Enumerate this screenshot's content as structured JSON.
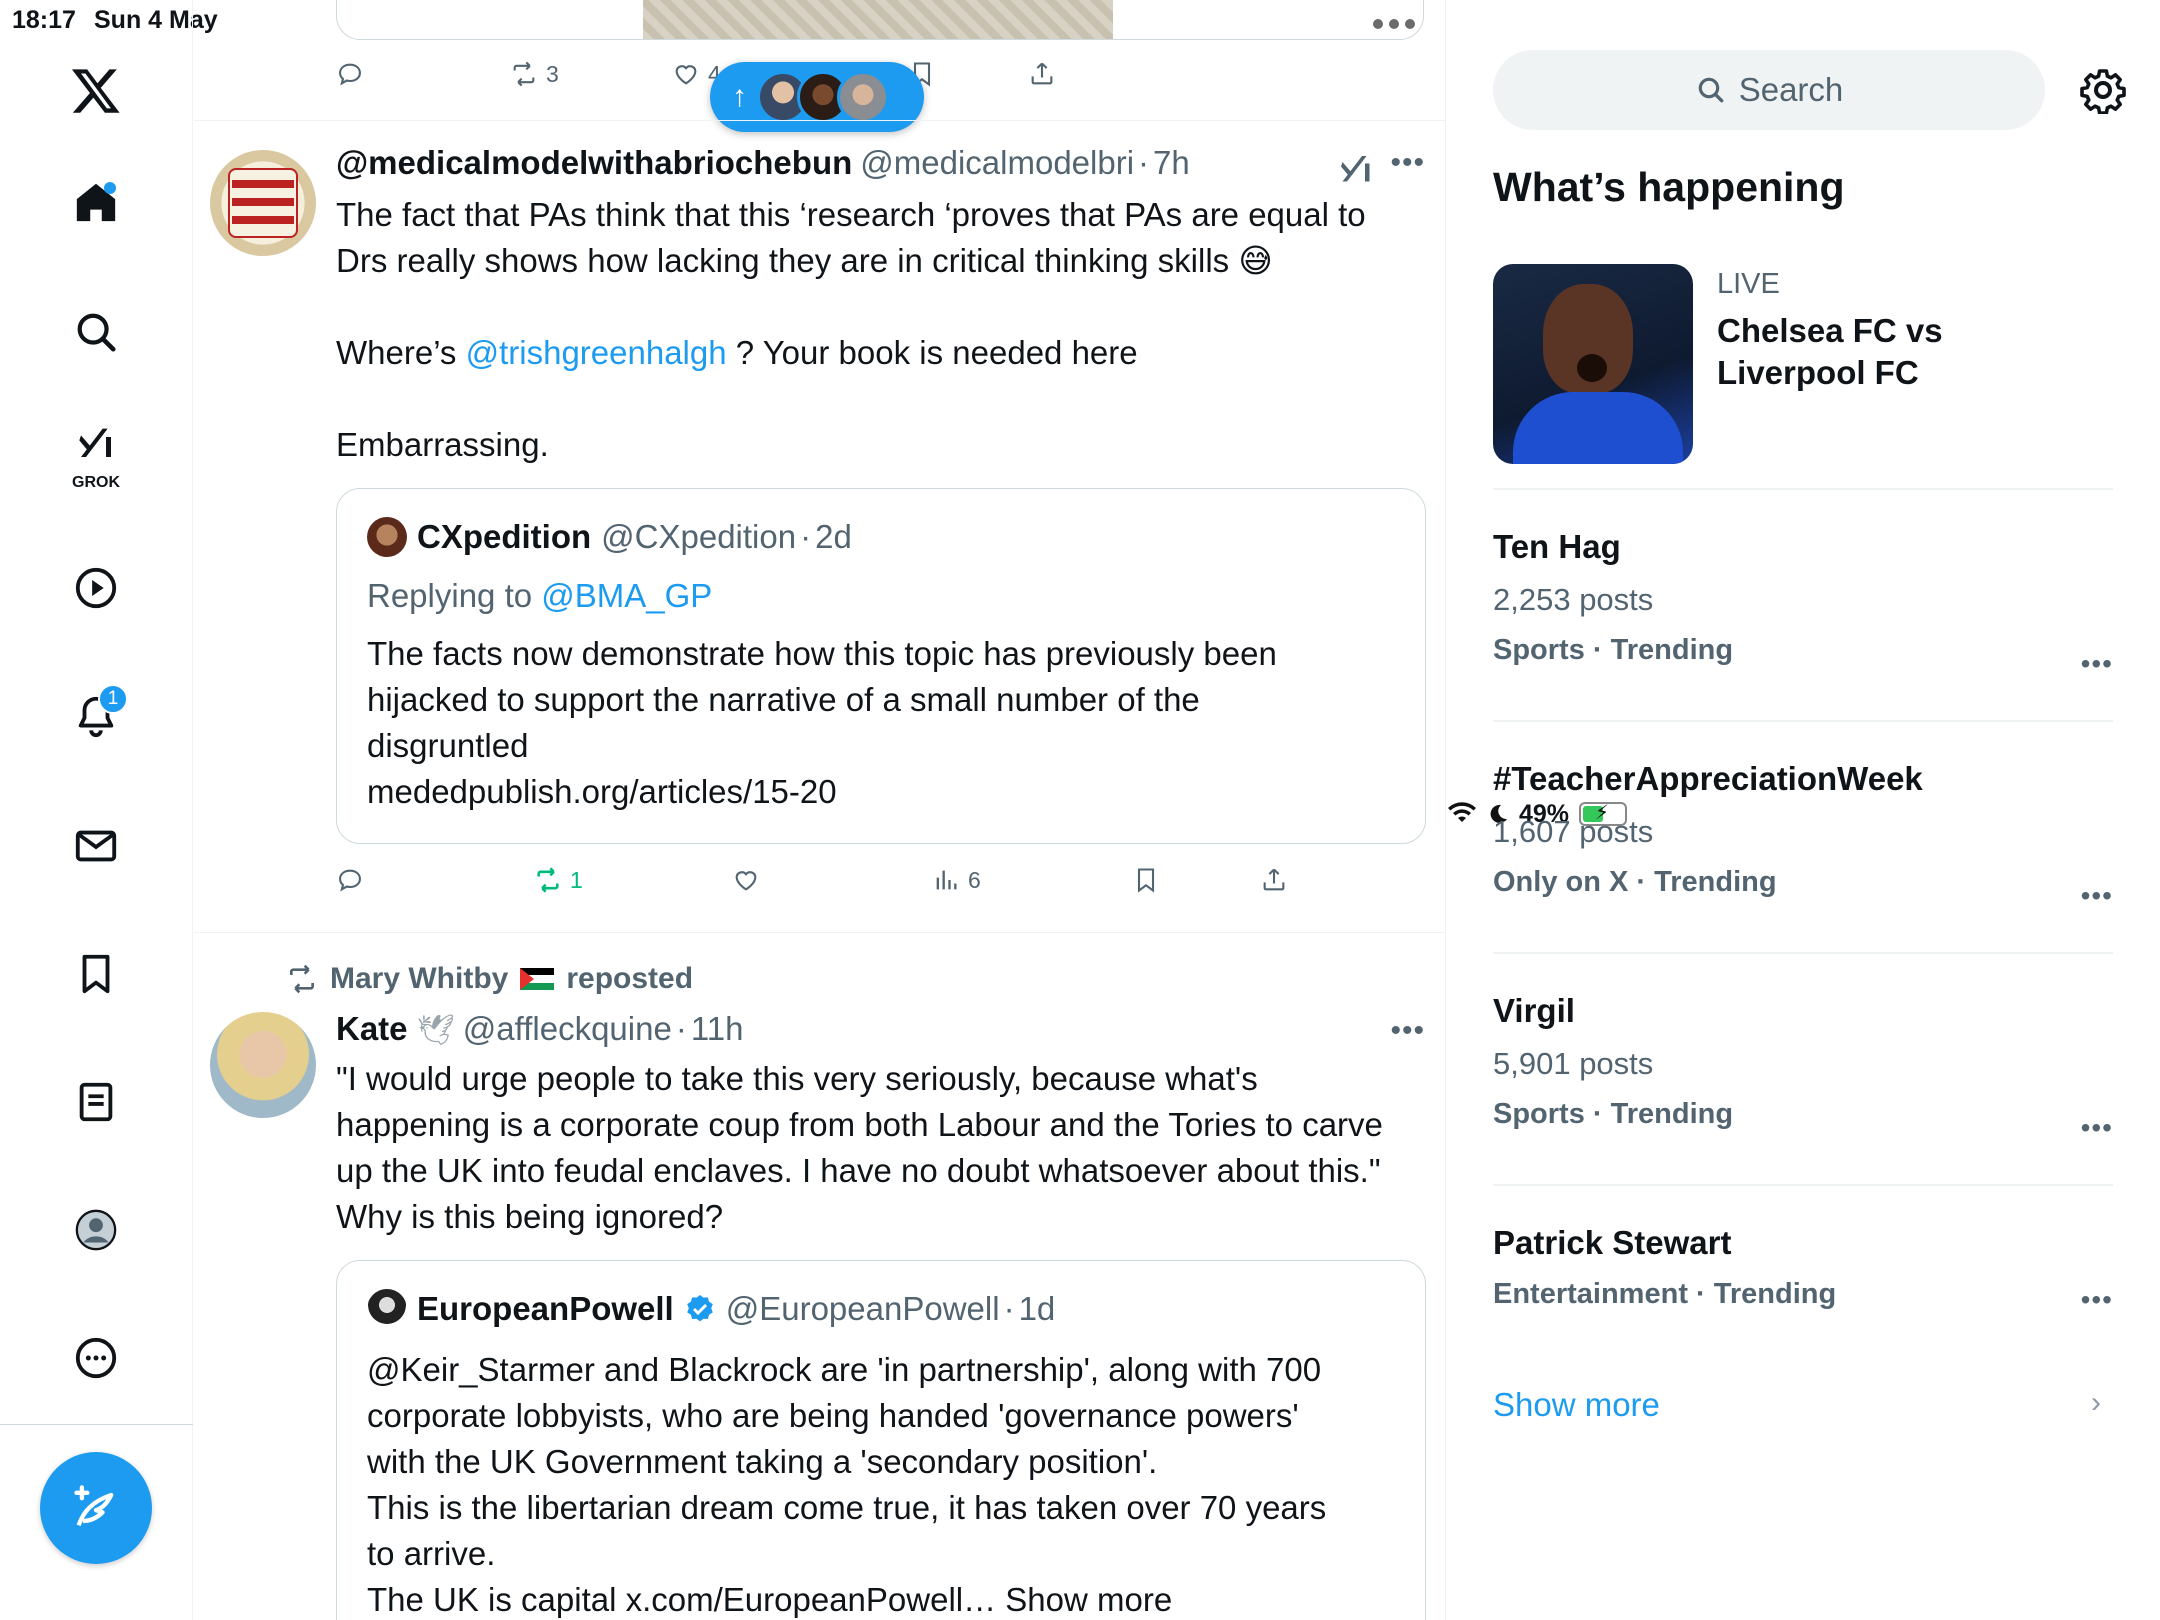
{
  "status": {
    "time": "18:17",
    "date": "Sun 4 May",
    "battery": "49%"
  },
  "nav": {
    "grok_label": "GROK",
    "notifications_badge": "1"
  },
  "top_actions": {
    "retweets": "3",
    "likes": "4"
  },
  "tweet1": {
    "name": "@medicalmodelwithabriochebun",
    "handle": "@medicalmodelbri",
    "time": "7h",
    "line1": "The fact that PAs think that this  ‘research ‘proves that PAs are equal to",
    "line2": "Drs really shows how lacking they are in critical thinking skills 😅",
    "line3_pre": "Where’s ",
    "line3_mention": "@trishgreenhalgh",
    "line3_post": " ? Your book is needed here",
    "line4": "Embarrassing.",
    "quote": {
      "name": "CXpedition",
      "handle": "@CXpedition",
      "time": "2d",
      "replying_prefix": "Replying to ",
      "replying_to": "@BMA_GP",
      "lines": [
        "The facts now demonstrate how this topic has previously been",
        "hijacked to support the narrative of a small number of the",
        "disgruntled",
        "mededpublish.org/articles/15-20"
      ]
    },
    "actions": {
      "retweets": "1",
      "views": "6"
    }
  },
  "tweet2": {
    "reposted_by": "Mary Whitby",
    "reposted_label": "reposted",
    "name": "Kate",
    "handle": "@affleckquine",
    "time": "11h",
    "lines": [
      "\"I would urge people to take this very seriously, because what's",
      "happening is a corporate coup from both Labour and the Tories to carve",
      "up the UK into feudal enclaves. I have no doubt whatsoever about this.\"",
      "Why is this being ignored?"
    ],
    "quote": {
      "name": "EuropeanPowell",
      "handle": "@EuropeanPowell",
      "time": "1d",
      "lines": [
        "@Keir_Starmer and Blackrock are 'in partnership', along with 700",
        "corporate lobbyists, who are being handed 'governance powers'",
        "with the UK Government taking a 'secondary position'.",
        "This is the libertarian dream come true, it has taken over 70 years",
        "to arrive.",
        "The UK is capital x.com/EuropeanPowell… Show more"
      ]
    }
  },
  "sidebar": {
    "search_placeholder": "Search",
    "title": "What’s happening",
    "live": {
      "label": "LIVE",
      "title_line1": "Chelsea FC vs",
      "title_line2": "Liverpool FC"
    },
    "trends": [
      {
        "name": "Ten Hag",
        "count": "2,253 posts",
        "meta": "Sports · Trending"
      },
      {
        "name": "#TeacherAppreciationWeek",
        "count": "1,607 posts",
        "meta": "Only on X · Trending"
      },
      {
        "name": "Virgil",
        "count": "5,901 posts",
        "meta": "Sports · Trending"
      },
      {
        "name": "Patrick Stewart",
        "count": "",
        "meta": "Entertainment · Trending"
      }
    ],
    "show_more": "Show more"
  },
  "colors": {
    "accent": "#1d9bf0",
    "text": "#0f1419",
    "muted": "#536471",
    "retweet_green": "#00ba7c"
  }
}
